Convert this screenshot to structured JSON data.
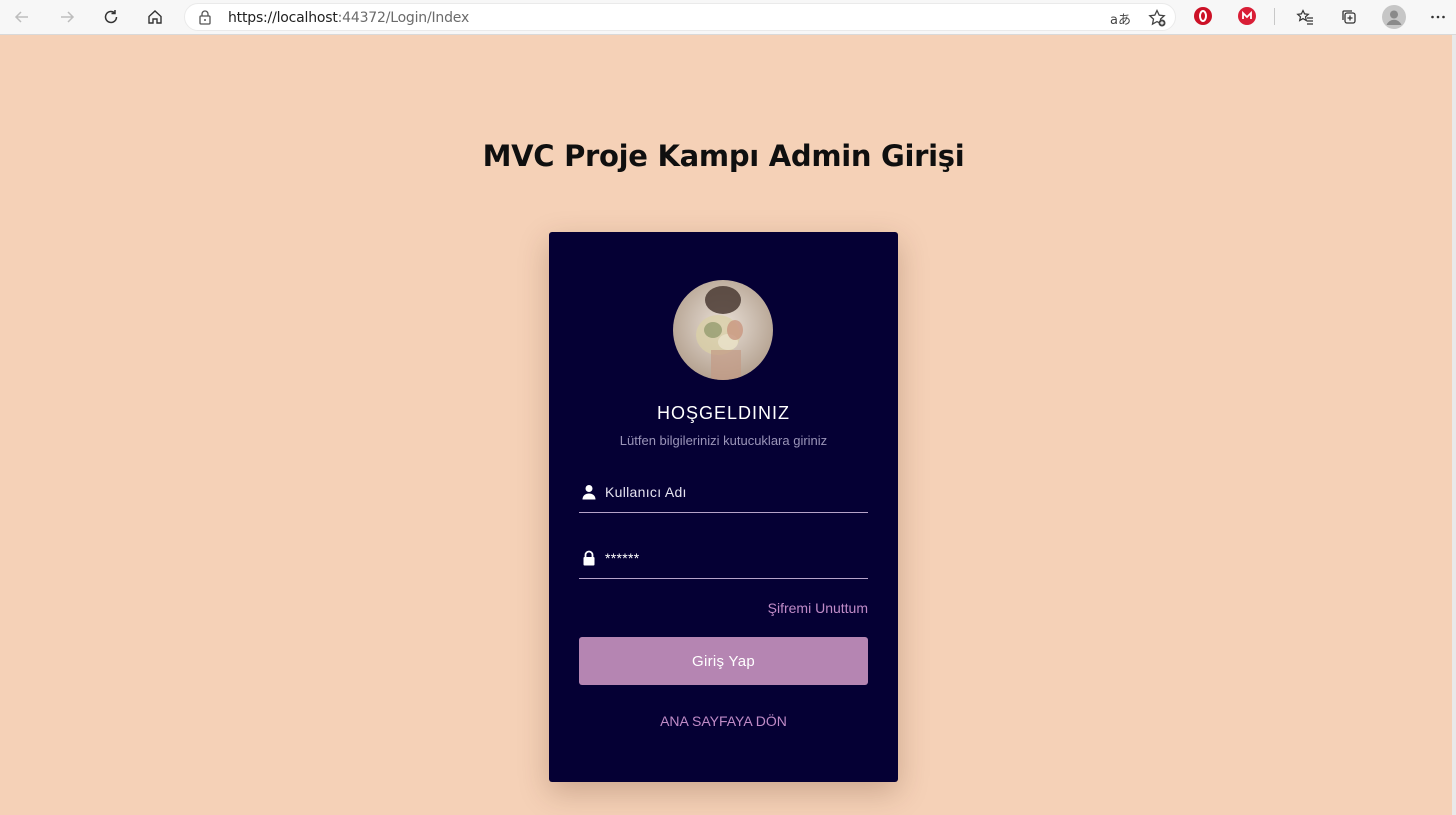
{
  "browser": {
    "url_host": "https://localhost",
    "url_rest": ":44372/Login/Index",
    "read_aloud_label": "aあ"
  },
  "page": {
    "title": "MVC Proje Kampı Admin Girişi"
  },
  "login_card": {
    "welcome": "HOŞGELDINIZ",
    "subtitle": "Lütfen bilgilerinizi kutucuklara giriniz",
    "username_placeholder": "Kullanıcı Adı",
    "password_value": "******",
    "forgot_password": "Şifremi Unuttum",
    "login_button": "Giriş Yap",
    "home_link": "ANA SAYFAYA DÖN"
  },
  "colors": {
    "page_background": "#f5d1b7",
    "card_background": "#050034",
    "button": "#b585b2",
    "link": "#c08bc7"
  }
}
